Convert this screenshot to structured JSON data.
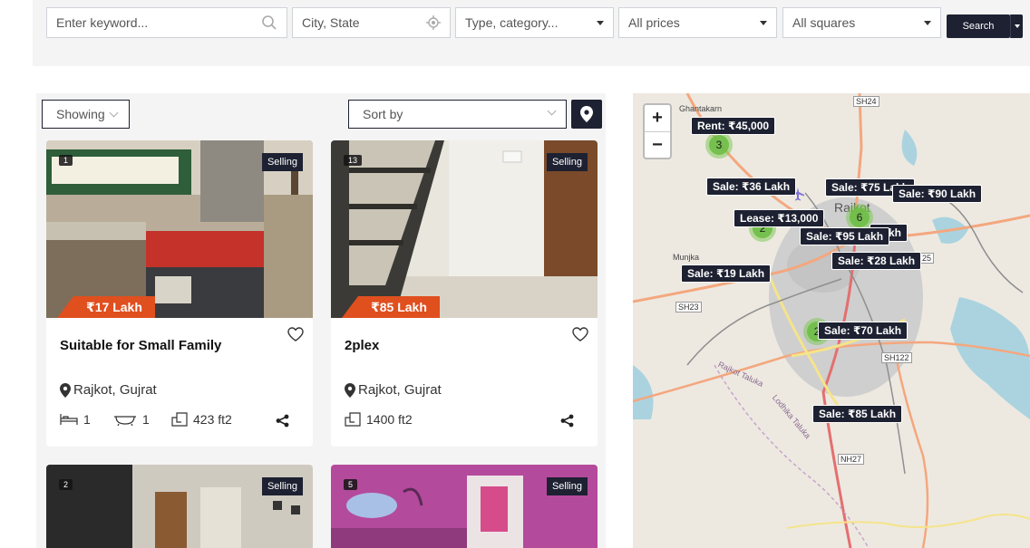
{
  "search": {
    "keyword_placeholder": "Enter keyword...",
    "location_placeholder": "City, State",
    "type_value": "Type, category...",
    "price_value": "All prices",
    "squares_value": "All squares",
    "button_label": "Search"
  },
  "filters": {
    "showing_label": "Showing",
    "sort_label": "Sort by"
  },
  "listings": [
    {
      "count": "1",
      "status": "Selling",
      "price": "₹17 Lakh",
      "title": "Suitable for Small Family",
      "location": "Rajkot, Gujrat",
      "beds": "1",
      "baths": "1",
      "area": "423 ft2"
    },
    {
      "count": "13",
      "status": "Selling",
      "price": "₹85 Lakh",
      "title": "2plex",
      "location": "Rajkot, Gujrat",
      "area": "1400 ft2"
    },
    {
      "count": "2",
      "status": "Selling"
    },
    {
      "count": "5",
      "status": "Selling"
    }
  ],
  "map": {
    "zoom_in": "+",
    "zoom_out": "−",
    "labels": [
      "Rent: ₹45,000",
      "Sale: ₹36 Lakh",
      "Sale: ₹75 Lakh",
      "Sale: ₹90 Lakh",
      "Lease: ₹13,000",
      "Sale: ₹95 Lakh",
      "Lakh",
      "Sale: ₹28 Lakh",
      "Sale: ₹19 Lakh",
      "Sale: ₹70 Lakh",
      "Sale: ₹85 Lakh"
    ],
    "clusters": [
      "3",
      "2",
      "6",
      "2"
    ],
    "places": [
      "Ghantakarn",
      "Rajkot",
      "Munjka",
      "Rajkot Taluka",
      "Lodhika Taluka"
    ],
    "roads": [
      "SH24",
      "SH23",
      "25",
      "SH122",
      "NH27"
    ]
  }
}
